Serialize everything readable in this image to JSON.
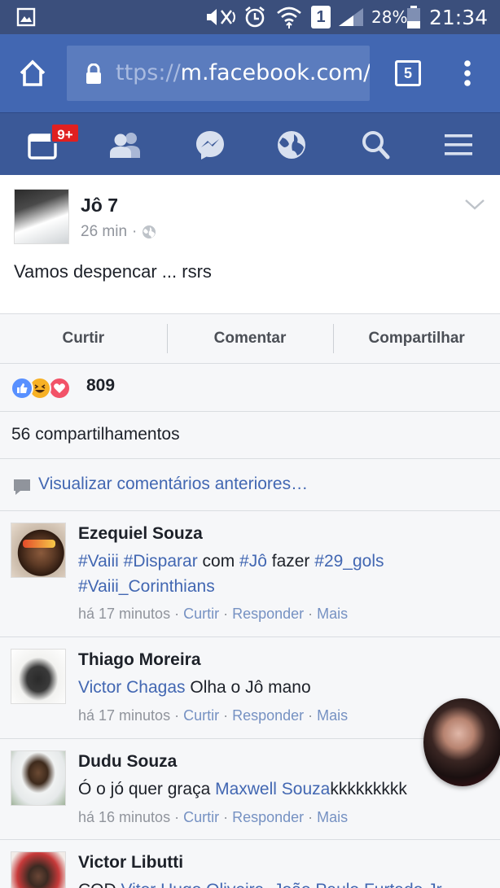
{
  "status_bar": {
    "battery": "28%",
    "time": "21:34",
    "sim": "1"
  },
  "browser": {
    "url_visible": "ttps://m.facebook.com/",
    "url_overflow": "s",
    "tab_count": "5"
  },
  "fb_nav": {
    "notification_badge": "9+"
  },
  "post": {
    "author": "Jô 7",
    "time": "26 min",
    "time_separator": "·",
    "text": "Vamos despencar ... rsrs"
  },
  "actions": {
    "like": "Curtir",
    "comment": "Comentar",
    "share": "Compartilhar"
  },
  "reactions": {
    "count": "809"
  },
  "shares": "56 compartilhamentos",
  "view_previous": "Visualizar comentários anteriores…",
  "comment_actions": {
    "like": "Curtir",
    "reply": "Responder",
    "more": "Mais",
    "sep": " · "
  },
  "comments": [
    {
      "name": "Ezequiel Souza",
      "line1": [
        "#Vaiii",
        " ",
        "#Disparar",
        " com ",
        "#Jô",
        " fazer ",
        "#29_gols"
      ],
      "line2": "#Vaiii_Corinthians",
      "time": "há 17 minutos"
    },
    {
      "name": "Thiago Moreira",
      "mention": "Victor Chagas",
      "text": " Olha o Jô mano",
      "time": "há 17 minutos"
    },
    {
      "name": "Dudu Souza",
      "text": "Ó o jó quer graça ",
      "mention": "Maxwell Souza",
      "text_after": "kkkkkkkkk",
      "time": "há 16 minutos"
    },
    {
      "name": "Victor Libutti",
      "text_start": "COD ",
      "mention": "Vitor Hugo Oliveira, João Paulo Furtado Jr"
    }
  ],
  "colors": {
    "status_bar": "#3b4f7c",
    "browser_bar": "#4267b2",
    "fb_blue": "#3b5998",
    "link": "#4267b2",
    "badge": "#e02020"
  }
}
